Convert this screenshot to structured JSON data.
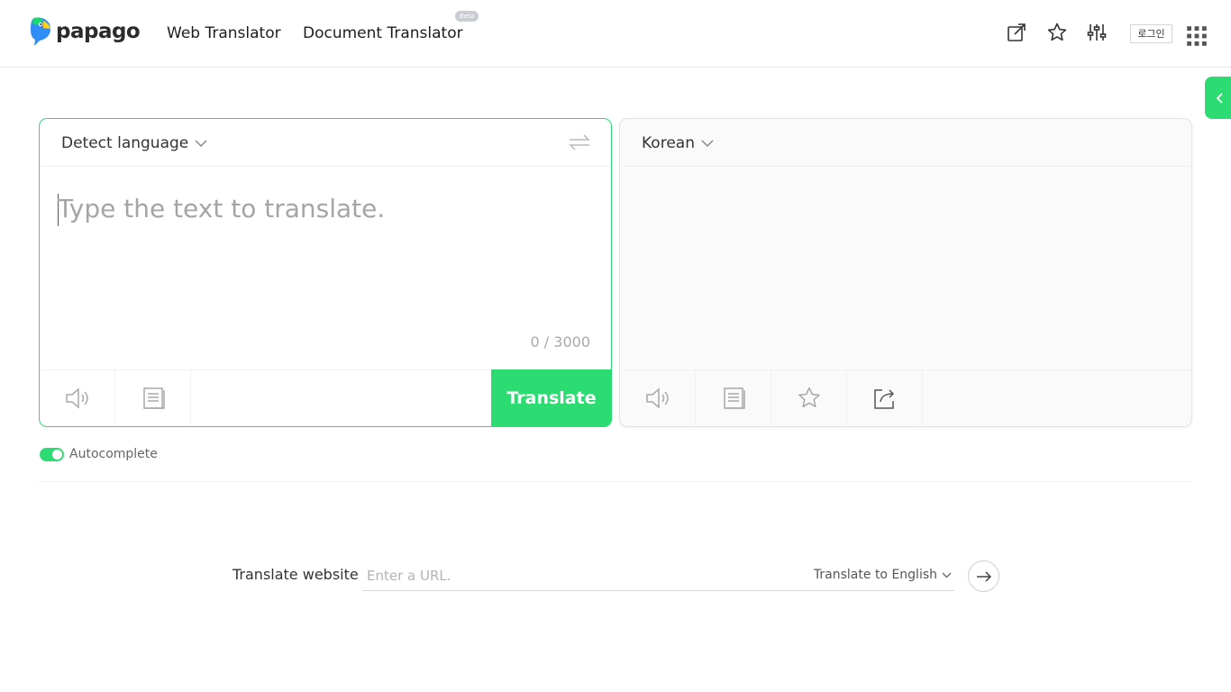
{
  "header": {
    "logo_text": "papago",
    "nav": {
      "web_translator": "Web Translator",
      "document_translator": "Document Translator",
      "beta": "Beta"
    },
    "login_label": "로그인"
  },
  "source_panel": {
    "language": "Detect language",
    "placeholder": "Type the text to translate.",
    "input_value": "",
    "char_count": "0 / 3000",
    "translate_label": "Translate"
  },
  "target_panel": {
    "language": "Korean",
    "output_text": ""
  },
  "autocomplete": {
    "label": "Autocomplete",
    "enabled": true
  },
  "website": {
    "label": "Translate website",
    "url_placeholder": "Enter a URL.",
    "target_language": "Translate to English"
  },
  "colors": {
    "accent": "#2ddb73"
  }
}
